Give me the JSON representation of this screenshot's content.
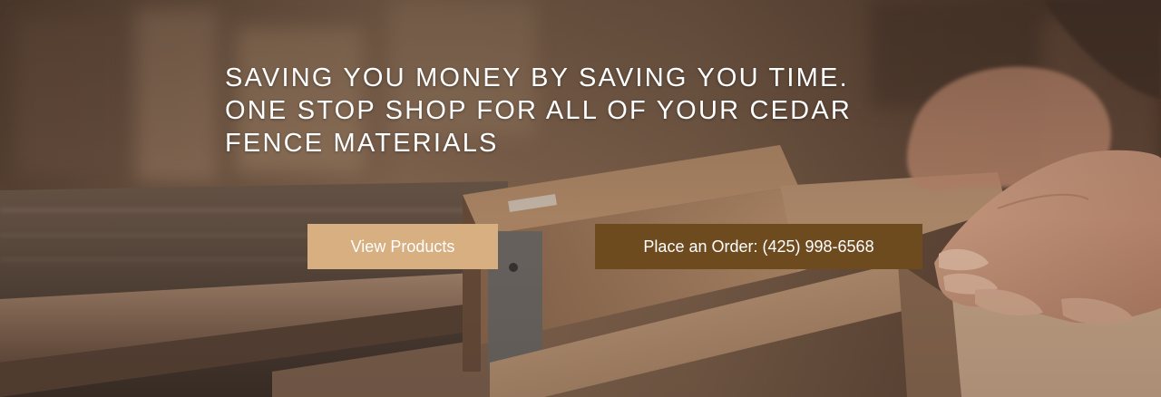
{
  "hero": {
    "headline": "SAVING YOU MONEY BY SAVING YOU TIME. ONE STOP SHOP FOR ALL OF YOUR CEDAR FENCE MATERIALS",
    "background_image": "woodworker-cutting-cedar-board-on-table-saw"
  },
  "buttons": {
    "view_products_label": "View Products",
    "place_order_label": "Place an Order: (425) 998-6568"
  },
  "colors": {
    "view_products_bg": "#d7af80",
    "place_order_bg": "#6e4a1f",
    "headline_text": "#ffffff"
  }
}
